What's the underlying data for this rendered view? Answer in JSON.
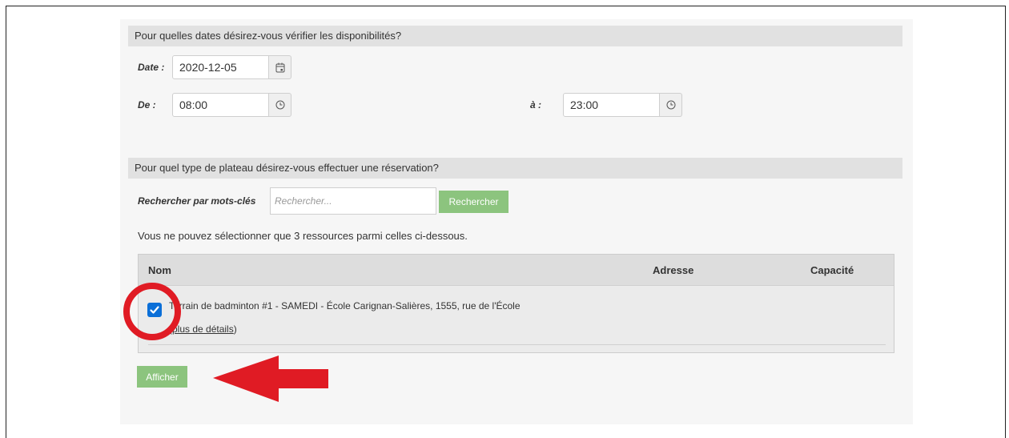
{
  "dates_section": {
    "header": "Pour quelles dates désirez-vous vérifier les disponibilités?",
    "date_label": "Date :",
    "date_value": "2020-12-05",
    "from_label": "De :",
    "from_value": "08:00",
    "to_label": "à :",
    "to_value": "23:00"
  },
  "type_section": {
    "header": "Pour quel type de plateau désirez-vous effectuer une réservation?",
    "search_label": "Rechercher par mots-clés",
    "search_placeholder": "Rechercher...",
    "search_button": "Rechercher",
    "info": "Vous ne pouvez sélectionner que 3 ressources parmi celles ci-dessous."
  },
  "table": {
    "columns": [
      "Nom",
      "Adresse",
      "Capacité"
    ],
    "rows": [
      {
        "checked": true,
        "name": "Terrain de badminton #1 - SAMEDI - École Carignan-Salières, 1555, rue de l'École",
        "details_link": "plus de détails"
      }
    ]
  },
  "show_button": "Afficher",
  "icons": [
    "calendar-icon",
    "clock-icon",
    "check-icon"
  ],
  "colors": {
    "accent_green": "#8cc47e",
    "annotation_red": "#e01b24",
    "checkbox_blue": "#0b6fd8"
  }
}
